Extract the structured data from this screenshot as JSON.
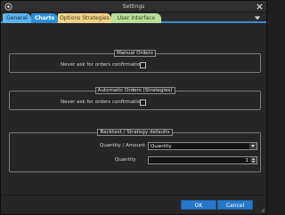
{
  "window": {
    "title": "Settings",
    "app_icon": "app-logo-icon",
    "close_icon": "close-icon"
  },
  "tabs": [
    {
      "label": "General",
      "color": "#5eb4ec"
    },
    {
      "label": "Charts",
      "color": "#2f8fd5",
      "active": true
    },
    {
      "label": "Options Strategies",
      "color": "#f0d48a"
    },
    {
      "label": "User Interface",
      "color": "#b9df9a"
    }
  ],
  "tab_menu_icon": "chevron-down-icon",
  "groups": {
    "manual": {
      "title": "Manual Orders",
      "label": "Never ask for orders confirmation",
      "checked": false
    },
    "automatic": {
      "title": "Automatic Orders (Strategies)",
      "label": "Never ask for orders confirmation",
      "checked": false
    },
    "backtest": {
      "title": "Backtest / Strategy defaults",
      "quantity_amount_label": "Quantity / Amount",
      "quantity_amount_value": "Quantity",
      "quantity_label": "Quantity",
      "quantity_value": "1"
    }
  },
  "footer": {
    "ok": "OK",
    "cancel": "Cancel"
  },
  "colors": {
    "accent": "#2f8fd5",
    "button": "#2577c7",
    "background": "#262626"
  }
}
